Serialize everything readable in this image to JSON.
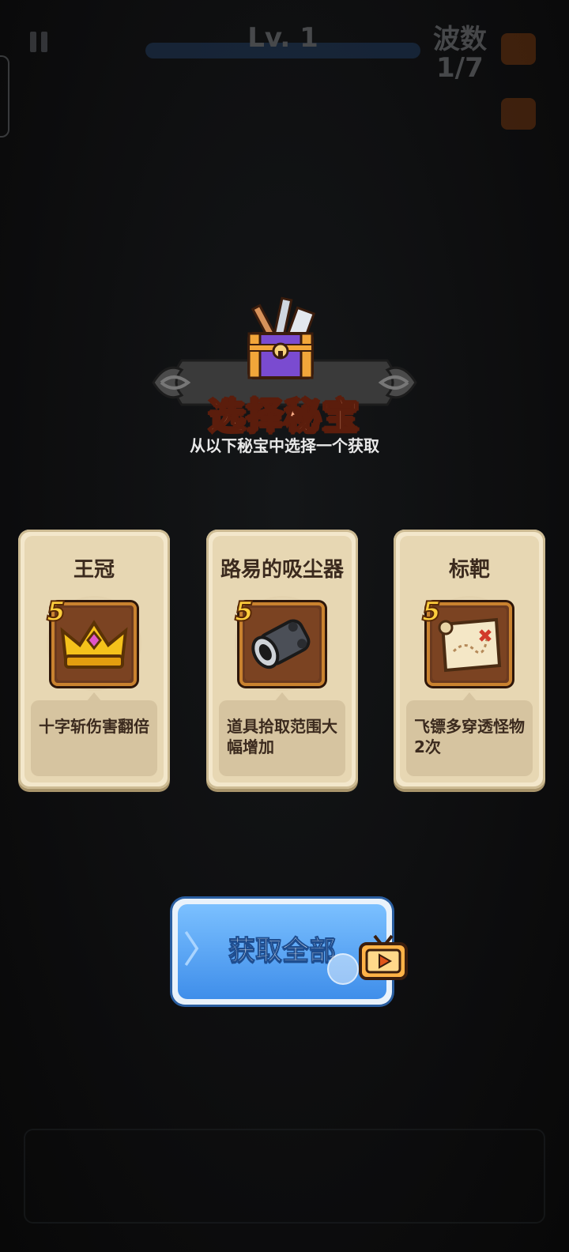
{
  "hud": {
    "level_label": "Lv. 1",
    "wave_label": "波数",
    "wave_value": "1/7"
  },
  "header": {
    "title": "选择秘宝",
    "subtitle": "从以下秘宝中选择一个获取"
  },
  "cards": [
    {
      "name": "王冠",
      "rank": "5",
      "icon": "crown-icon",
      "desc": "十字斩伤害翻倍"
    },
    {
      "name": "路易的吸尘器",
      "rank": "5",
      "icon": "cannon-icon",
      "desc": "道具拾取范围大幅增加"
    },
    {
      "name": "标靶",
      "rank": "5",
      "icon": "map-icon",
      "desc": "飞镖多穿透怪物2次"
    }
  ],
  "actions": {
    "get_all_label": "获取全部",
    "ad_icon": "video-ad-icon"
  },
  "colors": {
    "title_fill": "#ffb08a",
    "card_bg": "#f3e7cb",
    "button_blue": "#3f8eea"
  }
}
